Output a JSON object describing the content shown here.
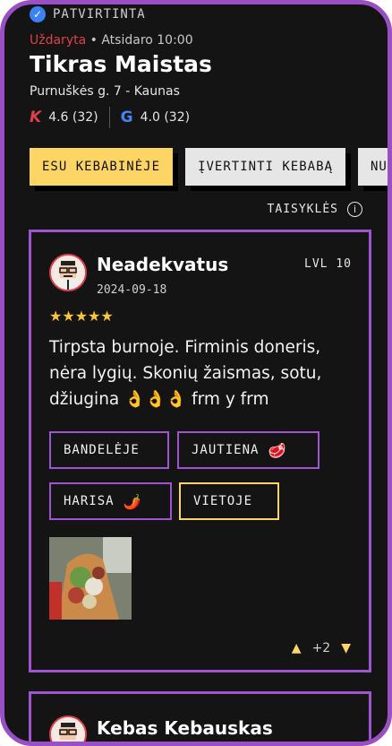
{
  "place": {
    "verified_label": "PATVIRTINTA",
    "status_closed": "Uždaryta",
    "status_separator": "•",
    "status_opens": "Atsidaro 10:00",
    "name": "Tikras Maistas",
    "address": "Purnuškės g. 7 - Kaunas",
    "rating_k": "4.6 (32)",
    "rating_google": "4.0 (32)"
  },
  "actions": {
    "primary": "ESU KEBABINĖJE",
    "secondary": "ĮVERTINTI KEBABĄ",
    "third": "NUV"
  },
  "rules_label": "TAISYKLĖS",
  "reviews": [
    {
      "name": "Neadekvatus",
      "date": "2024-09-18",
      "level": "LVL 10",
      "stars": "★★★★★",
      "text": "Tirpsta burnoje. Firminis doneris, nėra lygių. Skonių žaismas, sotu, džiugina 👌👌👌 frm y frm",
      "tags": [
        {
          "label": "BANDELĖJE",
          "emoji": ""
        },
        {
          "label": "JAUTIENA",
          "emoji": "🥩"
        },
        {
          "label": "HARISA",
          "emoji": "🌶️"
        },
        {
          "label": "VIETOJE",
          "emoji": ""
        }
      ],
      "vote_count": "+2"
    },
    {
      "name": "Kebas Kebauskas"
    }
  ],
  "icons": {
    "verified": "check-circle-icon",
    "info": "info-icon",
    "thumb_up": "thumbs-up-icon",
    "thumb_down": "thumbs-down-icon"
  },
  "colors": {
    "accent_purple": "#a055d0",
    "accent_yellow": "#fcd564",
    "closed_red": "#e0404a",
    "background": "#141414"
  }
}
